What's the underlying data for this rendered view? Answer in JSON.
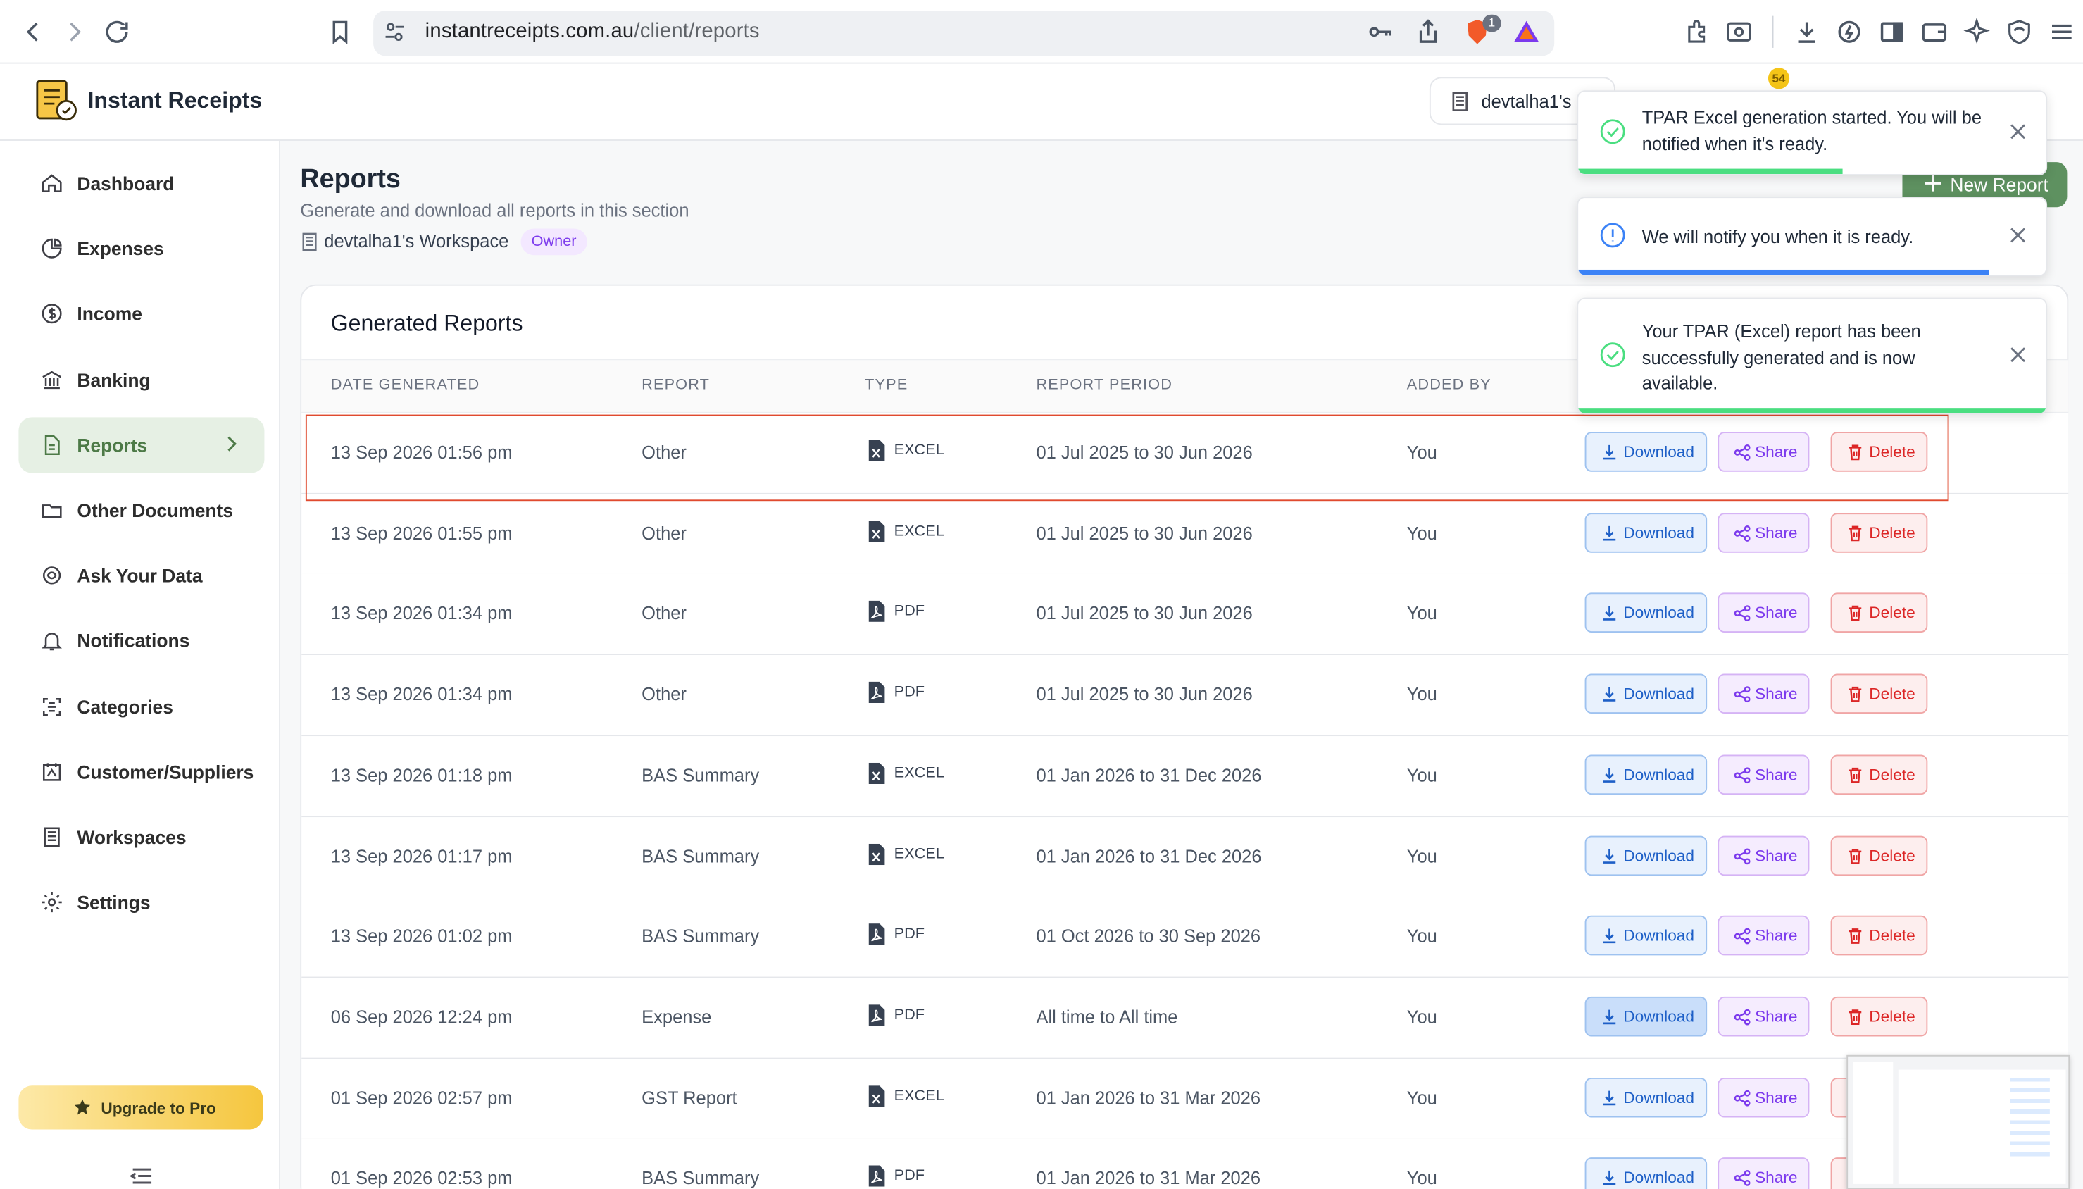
{
  "browser": {
    "url_host": "instantreceipts.com.au",
    "url_path": "/client/reports",
    "brave_count": "1"
  },
  "app": {
    "name": "Instant Receipts",
    "workspace_pill": "devtalha1's",
    "notification_count": "54"
  },
  "sidebar": {
    "items": [
      {
        "label": "Dashboard",
        "icon": "home-icon"
      },
      {
        "label": "Expenses",
        "icon": "pie-chart-icon"
      },
      {
        "label": "Income",
        "icon": "dollar-circle-icon"
      },
      {
        "label": "Banking",
        "icon": "bank-icon"
      },
      {
        "label": "Reports",
        "icon": "document-icon"
      },
      {
        "label": "Other Documents",
        "icon": "folder-icon"
      },
      {
        "label": "Ask Your Data",
        "icon": "ai-icon"
      },
      {
        "label": "Notifications",
        "icon": "bell-icon"
      },
      {
        "label": "Categories",
        "icon": "scan-icon"
      },
      {
        "label": "Customer/Suppliers",
        "icon": "contact-icon"
      },
      {
        "label": "Workspaces",
        "icon": "workspace-icon"
      },
      {
        "label": "Settings",
        "icon": "gear-icon"
      }
    ],
    "upgrade_label": "Upgrade to Pro"
  },
  "page": {
    "title": "Reports",
    "subtitle": "Generate and download all reports in this section",
    "workspace": "devtalha1's Workspace",
    "role": "Owner",
    "new_report": "New Report"
  },
  "table": {
    "title": "Generated Reports",
    "headers": [
      "DATE GENERATED",
      "REPORT",
      "TYPE",
      "REPORT PERIOD",
      "ADDED BY"
    ],
    "actions": {
      "download": "Download",
      "share": "Share",
      "delete": "Delete"
    },
    "rows": [
      {
        "date": "13 Sep 2026 01:56 pm",
        "report": "Other",
        "type": "EXCEL",
        "period": "01 Jul 2025 to 30 Jun 2026",
        "added_by": "You"
      },
      {
        "date": "13 Sep 2026 01:55 pm",
        "report": "Other",
        "type": "EXCEL",
        "period": "01 Jul 2025 to 30 Jun 2026",
        "added_by": "You"
      },
      {
        "date": "13 Sep 2026 01:34 pm",
        "report": "Other",
        "type": "PDF",
        "period": "01 Jul 2025 to 30 Jun 2026",
        "added_by": "You"
      },
      {
        "date": "13 Sep 2026 01:34 pm",
        "report": "Other",
        "type": "PDF",
        "period": "01 Jul 2025 to 30 Jun 2026",
        "added_by": "You"
      },
      {
        "date": "13 Sep 2026 01:18 pm",
        "report": "BAS Summary",
        "type": "EXCEL",
        "period": "01 Jan 2026 to 31 Dec 2026",
        "added_by": "You"
      },
      {
        "date": "13 Sep 2026 01:17 pm",
        "report": "BAS Summary",
        "type": "EXCEL",
        "period": "01 Jan 2026 to 31 Dec 2026",
        "added_by": "You"
      },
      {
        "date": "13 Sep 2026 01:02 pm",
        "report": "BAS Summary",
        "type": "PDF",
        "period": "01 Oct 2026 to 30 Sep 2026",
        "added_by": "You"
      },
      {
        "date": "06 Sep 2026 12:24 pm",
        "report": "Expense",
        "type": "PDF",
        "period": "All time to All time",
        "added_by": "You"
      },
      {
        "date": "01 Sep 2026 02:57 pm",
        "report": "GST Report",
        "type": "EXCEL",
        "period": "01 Jan 2026 to 31 Mar 2026",
        "added_by": "You"
      },
      {
        "date": "01 Sep 2026 02:53 pm",
        "report": "BAS Summary",
        "type": "PDF",
        "period": "01 Jan 2026 to 31 Mar 2026",
        "added_by": "You"
      }
    ]
  },
  "toasts": [
    {
      "text": "TPAR Excel generation started. You will be notified when it's ready.",
      "kind": "success",
      "color": "#4ade80"
    },
    {
      "text": "We will notify you when it is ready.",
      "kind": "info",
      "color": "#3b82f6"
    },
    {
      "text": "Your TPAR (Excel) report has been successfully generated and is now available.",
      "kind": "success",
      "color": "#4ade80"
    }
  ],
  "colors": {
    "accent": "#5e9160",
    "active_bg": "#e6f0e4",
    "highlight": "#e04a2f"
  }
}
